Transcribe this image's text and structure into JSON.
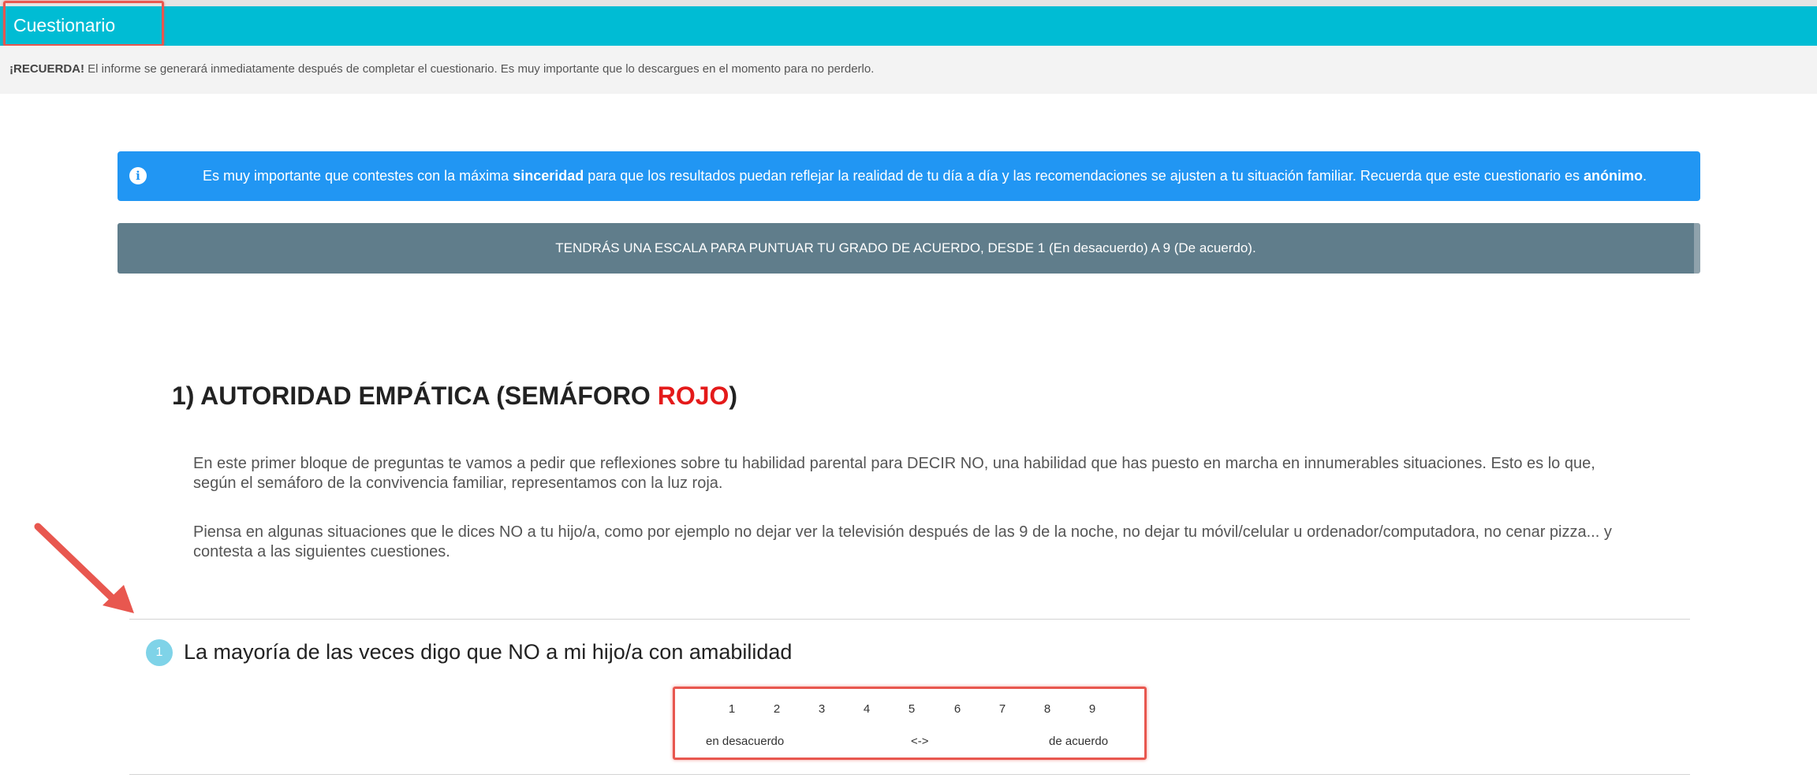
{
  "header": {
    "title": "Cuestionario"
  },
  "notice": {
    "bold": "¡RECUERDA!",
    "text": " El informe se generará inmediatamente después de completar el cuestionario. Es muy importante que lo descargues en el momento para no perderlo."
  },
  "info_alert": {
    "icon": "info-icon",
    "text_1": "Es muy importante que contestes con la máxima ",
    "bold_1": "sinceridad",
    "text_2": " para que los resultados puedan reflejar la realidad de tu día a día y las recomendaciones se ajusten a tu situación familiar. Recuerda que este cuestionario es ",
    "bold_2": "anónimo",
    "text_3": ".",
    "color": "#2196f3"
  },
  "scale_banner": {
    "text": "TENDRÁS UNA ESCALA PARA PUNTUAR TU GRADO DE ACUERDO, DESDE 1 (En desacuerdo) A 9 (De acuerdo).",
    "color": "#607d8b"
  },
  "section": {
    "title_prefix": "1) AUTORIDAD EMPÁTICA (SEMÁFORO ",
    "title_red": "ROJO",
    "title_suffix": ")",
    "paragraph_1": "En este primer bloque de preguntas te vamos a pedir que reflexiones sobre tu habilidad parental para DECIR NO, una habilidad que has puesto en marcha en innumerables situaciones. Esto es lo que, según el semáforo de la convivencia familiar, representamos con la luz roja.",
    "paragraph_2": "Piensa en algunas situaciones que le dices NO a tu hijo/a, como por ejemplo no dejar ver la televisión después de las 9 de la noche, no dejar tu móvil/celular u ordenador/computadora, no cenar pizza... y contesta a las siguientes cuestiones."
  },
  "question": {
    "number": "1",
    "text": "La mayoría de las veces digo que NO a mi hijo/a con amabilidad",
    "scale": [
      "1",
      "2",
      "3",
      "4",
      "5",
      "6",
      "7",
      "8",
      "9"
    ],
    "label_left": "en desacuerdo",
    "label_middle": "<->",
    "label_right": "de acuerdo"
  },
  "annotation_color": "#e8574f"
}
